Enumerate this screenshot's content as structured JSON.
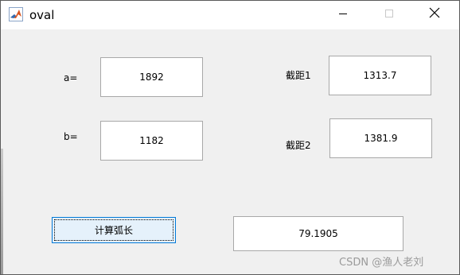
{
  "window": {
    "title": "oval",
    "app_icon": "matlab-icon",
    "controls": [
      "minimize-icon",
      "maximize-icon",
      "close-icon"
    ]
  },
  "form": {
    "a_label": "a=",
    "a_value": "1892",
    "b_label": "b=",
    "b_value": "1182",
    "intercept1_label": "截距1",
    "intercept1_value": "1313.7",
    "intercept2_label": "截距2",
    "intercept2_value": "1381.9",
    "calc_button_label": "计算弧长",
    "result_value": "79.1905"
  },
  "watermark": "CSDN @渔人老刘"
}
